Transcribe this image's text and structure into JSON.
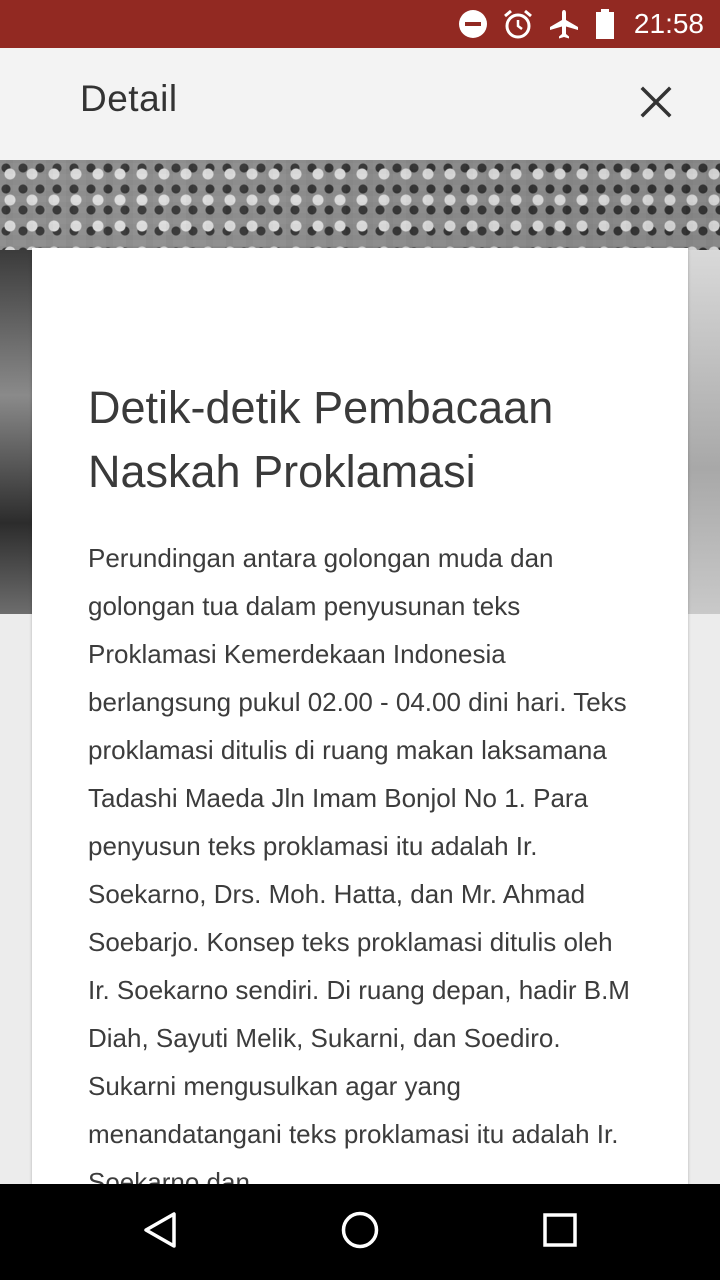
{
  "status_bar": {
    "time": "21:58",
    "icons": [
      "do-not-disturb-icon",
      "alarm-icon",
      "airplane-mode-icon",
      "battery-icon"
    ],
    "background": "#922922"
  },
  "app_bar": {
    "title": "Detail",
    "close_icon": "close-icon"
  },
  "article": {
    "title": "Detik-detik Pembacaan Naskah Proklamasi",
    "body": "Perundingan antara golongan muda dan golongan tua dalam penyusunan teks Proklamasi Kemerdekaan Indonesia berlangsung pukul 02.00 - 04.00 dini hari. Teks proklamasi ditulis di ruang makan laksamana Tadashi Maeda Jln Imam Bonjol No 1. Para penyusun teks proklamasi itu adalah Ir. Soekarno, Drs. Moh. Hatta, dan Mr. Ahmad Soebarjo. Konsep teks proklamasi ditulis oleh Ir. Soekarno sendiri. Di ruang depan, hadir B.M Diah, Sayuti Melik, Sukarni, dan Soediro. Sukarni mengusulkan agar yang menandatangani teks proklamasi itu adalah Ir. Soekarno dan"
  },
  "nav_bar": {
    "buttons": [
      "back-icon",
      "home-icon",
      "recents-icon"
    ]
  }
}
